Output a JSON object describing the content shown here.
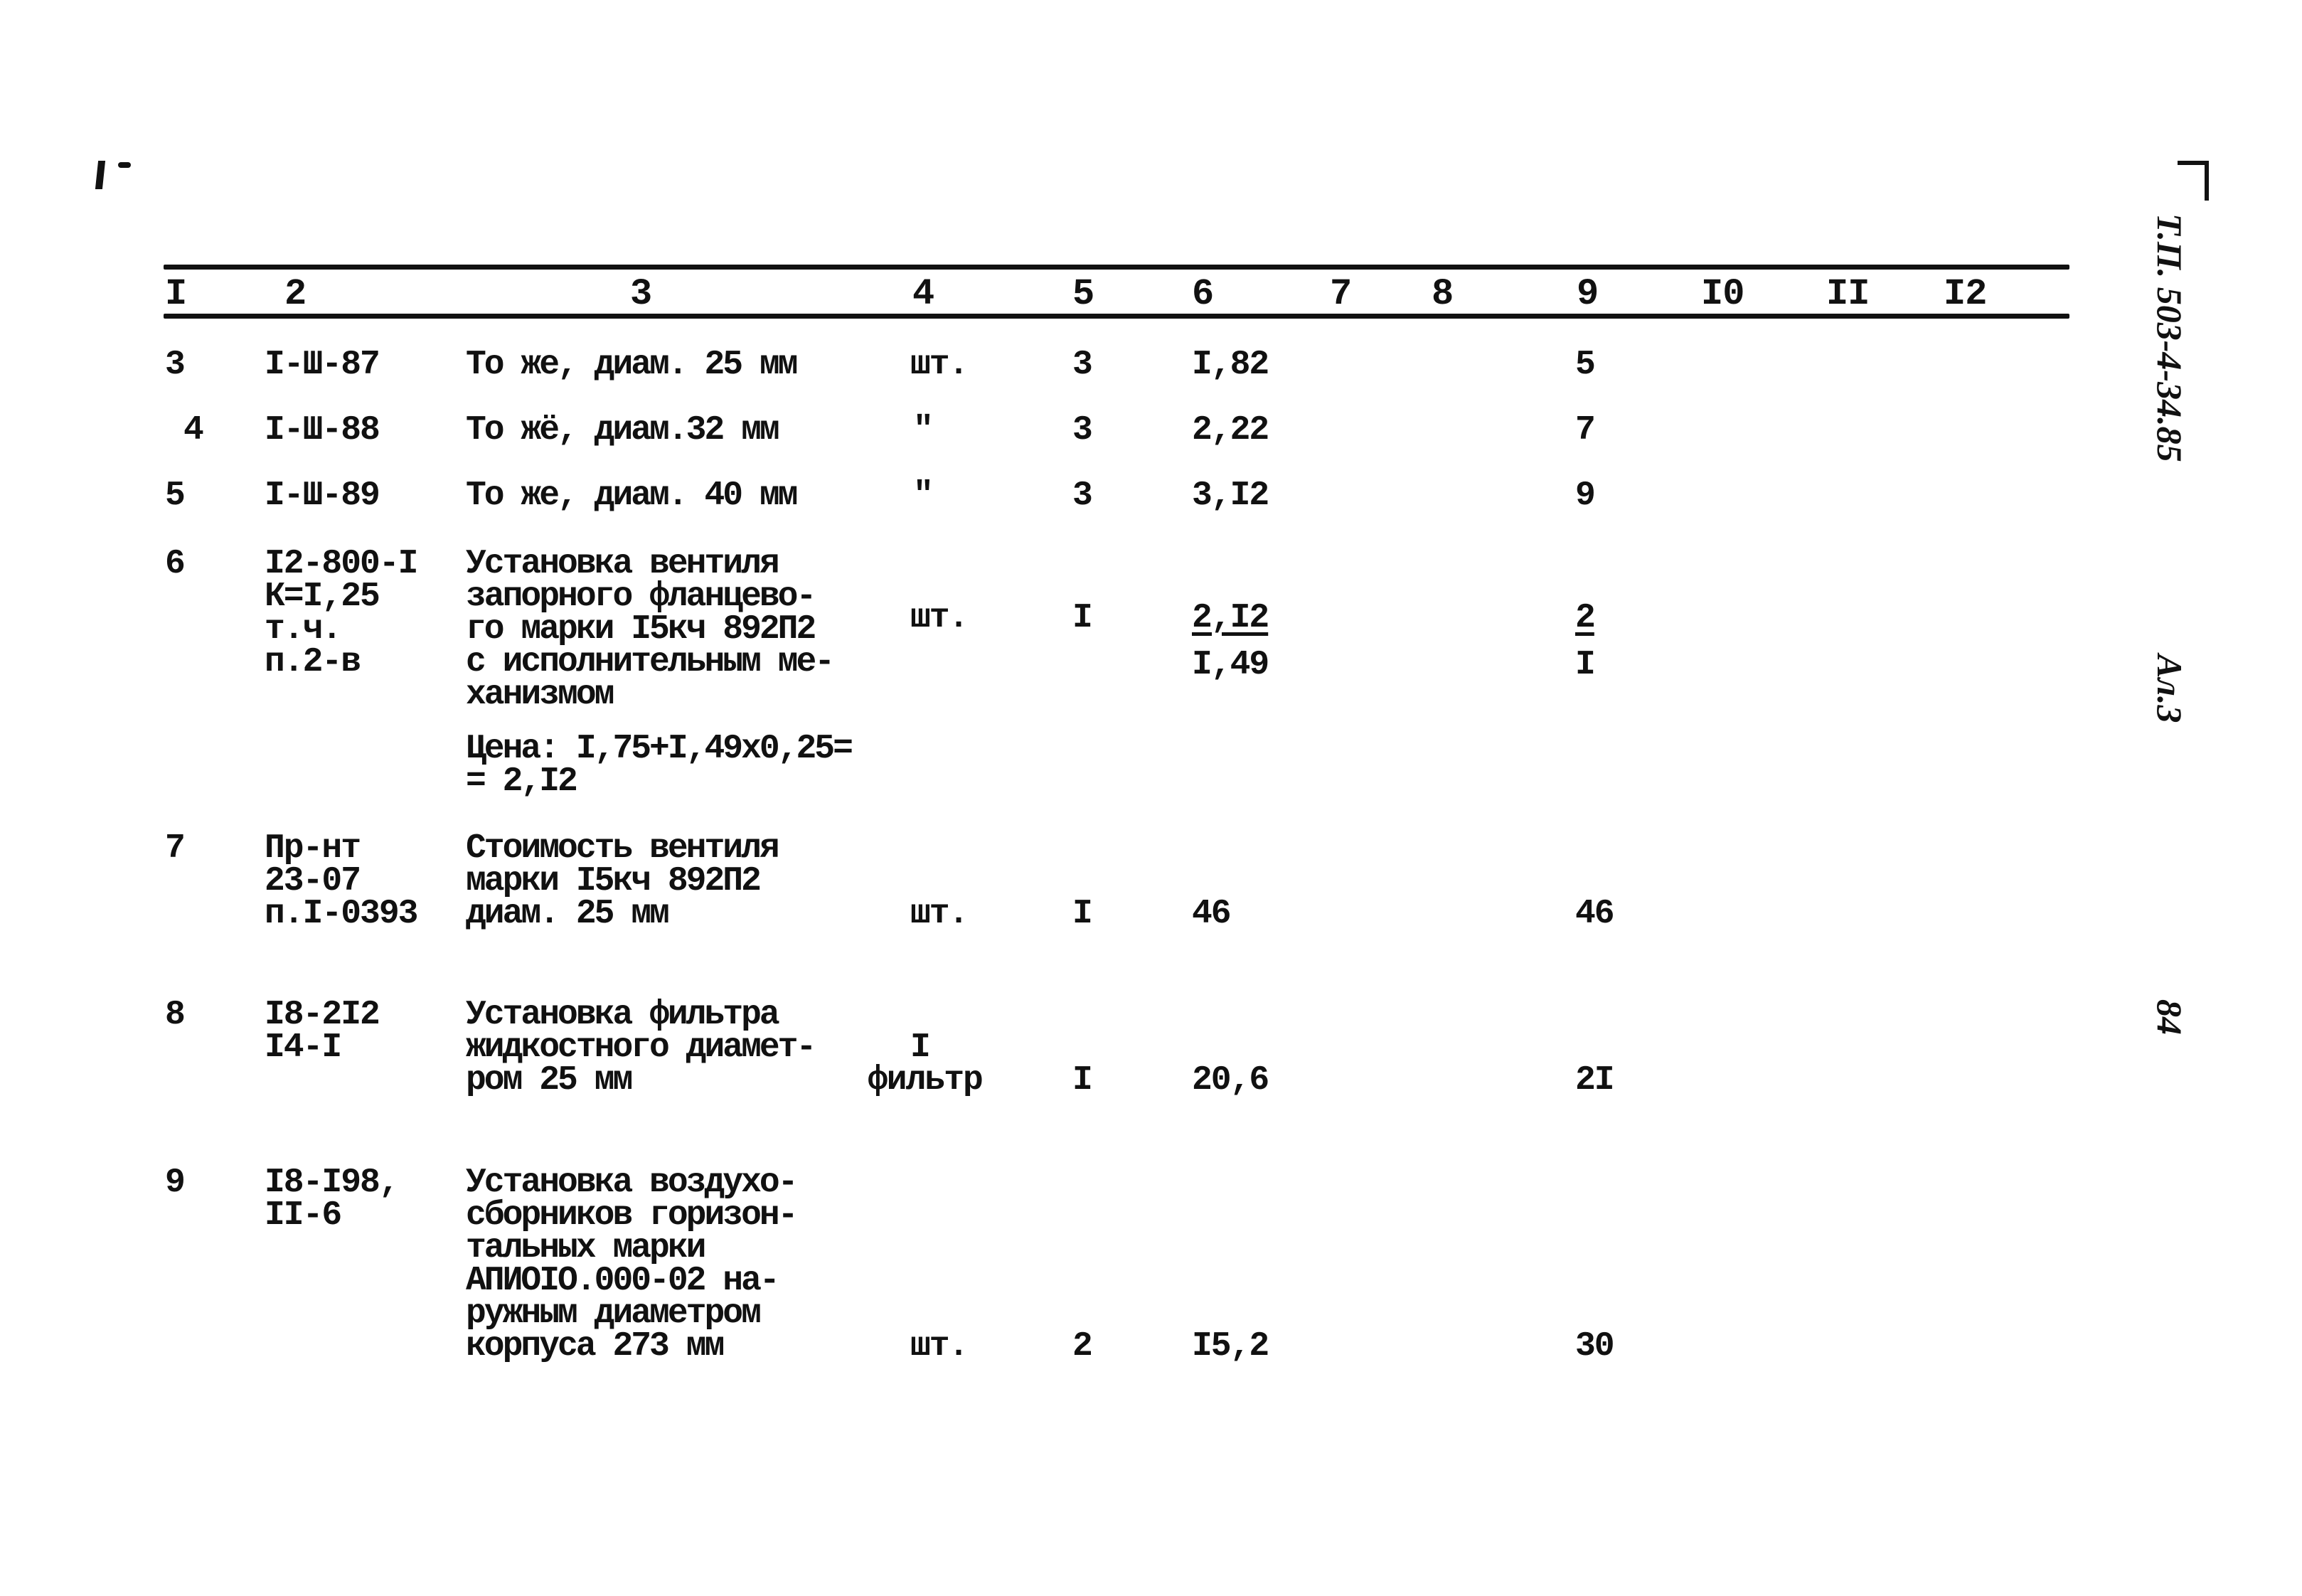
{
  "document": {
    "margin_code": "Т.П. 503-4-34.85",
    "margin_sheet": "Ал.3",
    "page_number": "84"
  },
  "table": {
    "column_headers": [
      "I",
      "2",
      "3",
      "4",
      "5",
      "6",
      "7",
      "8",
      "9",
      "I0",
      "II",
      "I2"
    ],
    "rows": [
      {
        "num": "3",
        "code": [
          "I-Ш-87"
        ],
        "desc": [
          "То же, диам. 25 мм"
        ],
        "unit": [
          "шт."
        ],
        "qty": "3",
        "price": "I,82",
        "price_sub": "",
        "total": "5",
        "total_sub": ""
      },
      {
        "num": "4",
        "code": [
          "I-Ш-88"
        ],
        "desc": [
          "То жё, диам.32 мм"
        ],
        "unit": [
          "\""
        ],
        "qty": "3",
        "price": "2,22",
        "price_sub": "",
        "total": "7",
        "total_sub": ""
      },
      {
        "num": "5",
        "code": [
          "I-Ш-89"
        ],
        "desc": [
          "То же, диам. 40 мм"
        ],
        "unit": [
          "\""
        ],
        "qty": "3",
        "price": "3,I2",
        "price_sub": "",
        "total": "9",
        "total_sub": ""
      },
      {
        "num": "6",
        "code": [
          "I2-800-I",
          "К=I,25",
          "т.ч.",
          "п.2-в"
        ],
        "desc": [
          "Установка вентиля",
          "запорного фланцево-",
          "го марки I5кч 892П2",
          "с исполнительным ме-",
          "ханизмом"
        ],
        "note": [
          "Цена: I,75+I,49x0,25=",
          "= 2,I2"
        ],
        "unit": [
          "шт."
        ],
        "qty": "I",
        "price": "2,I2",
        "price_sub": "I,49",
        "total": "2",
        "total_sub": "I"
      },
      {
        "num": "7",
        "code": [
          "Пр-нт",
          "23-07",
          "п.I-0393"
        ],
        "desc": [
          "Стоимость вентиля",
          "марки I5кч 892П2",
          "диам. 25 мм"
        ],
        "unit": [
          "шт."
        ],
        "qty": "I",
        "price": "46",
        "price_sub": "",
        "total": "46",
        "total_sub": ""
      },
      {
        "num": "8",
        "code": [
          "I8-2I2",
          "I4-I"
        ],
        "desc": [
          "Установка фильтра",
          "жидкостного диамет-",
          "ром 25 мм"
        ],
        "unit": [
          "I",
          "фильтр"
        ],
        "qty": "I",
        "price": "20,6",
        "price_sub": "",
        "total": "2I",
        "total_sub": ""
      },
      {
        "num": "9",
        "code": [
          "I8-I98,",
          "II-6"
        ],
        "desc": [
          "Установка воздухо-",
          "сборников горизон-",
          "тальных марки",
          "АПИОIO.000-02 на-",
          "ружным диаметром",
          "корпуса 273 мм"
        ],
        "unit": [
          "шт."
        ],
        "qty": "2",
        "price": "I5,2",
        "price_sub": "",
        "total": "30",
        "total_sub": ""
      }
    ]
  }
}
